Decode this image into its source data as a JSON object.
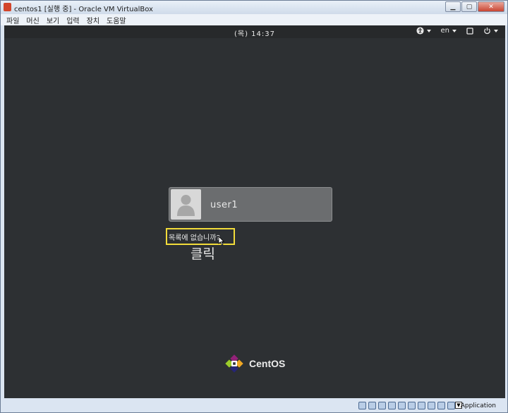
{
  "window": {
    "title": "centos1 [실행 중] - Oracle VM VirtualBox",
    "min_label": "▁",
    "max_label": "▢",
    "close_label": "✕"
  },
  "menubar": {
    "items": [
      "파일",
      "머신",
      "보기",
      "입력",
      "장치",
      "도움말"
    ]
  },
  "gnome": {
    "clock": "(목) 14:37",
    "accessibility_icon": "accessibility-icon",
    "language": "en",
    "screen_icon": "display-icon",
    "power_icon": "power-icon"
  },
  "login": {
    "username": "user1",
    "not_listed": "목록에 없습니까?",
    "annotation": "클릭"
  },
  "logo": {
    "text": "CentOS"
  },
  "statusbar": {
    "host_key": "Application",
    "icons": [
      "hard-disk-icon",
      "optical-drive-icon",
      "audio-icon",
      "network-icon",
      "usb-icon",
      "shared-folder-icon",
      "display-icon",
      "video-capture-icon",
      "cpu-icon",
      "mouse-integration-icon"
    ]
  },
  "colors": {
    "screen_bg": "#2d3033",
    "highlight": "#f2dc3a",
    "card_bg": "#6b6d6f"
  }
}
